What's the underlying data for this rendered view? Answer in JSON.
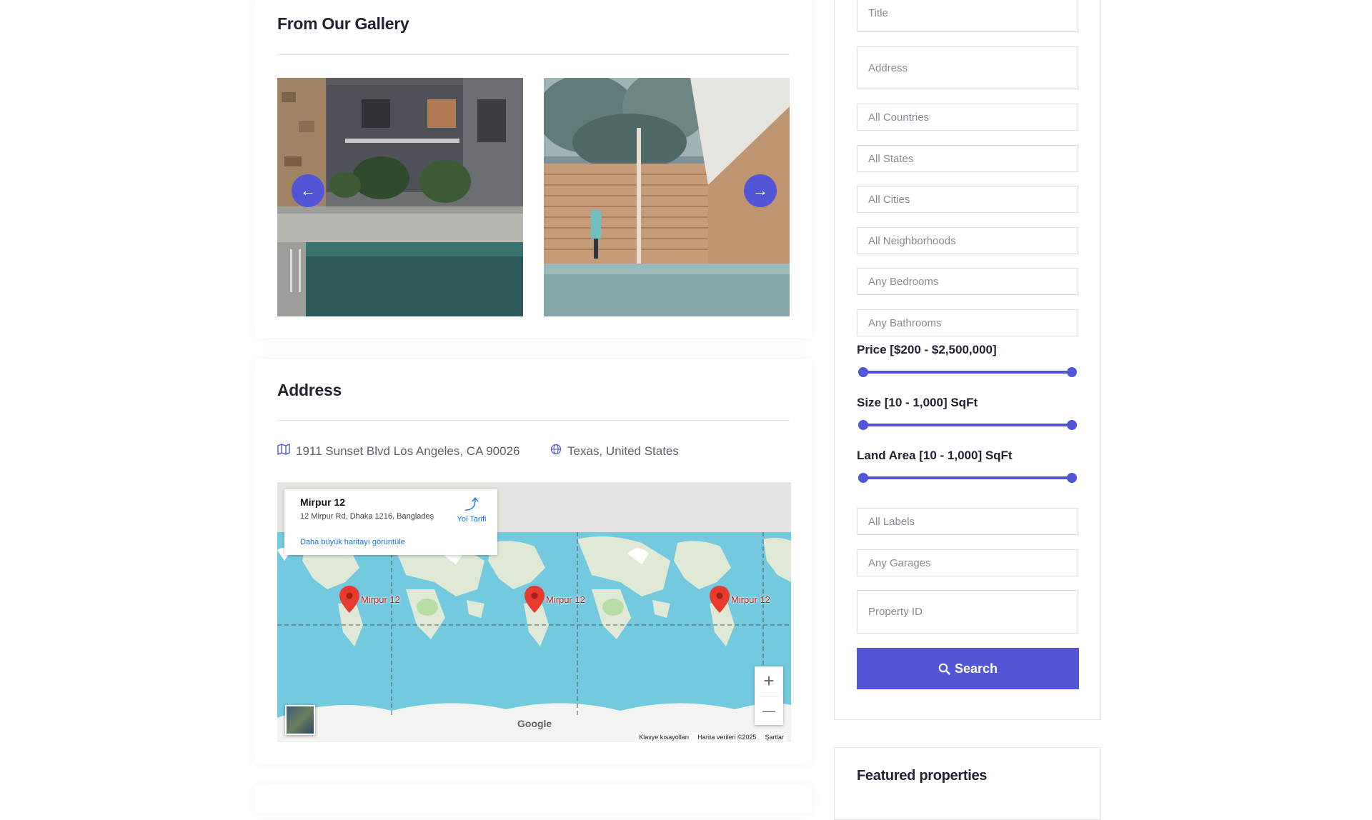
{
  "gallery": {
    "title": "From Our Gallery",
    "prev_icon": "arrow-left-icon",
    "next_icon": "arrow-right-icon"
  },
  "address": {
    "title": "Address",
    "street": "1911 Sunset Blvd Los Angeles, CA 90026",
    "region": "Texas, United States",
    "street_icon": "map-icon",
    "region_icon": "globe-icon"
  },
  "map": {
    "place_name": "Mirpur 12",
    "place_address": "12 Mirpur Rd, Dhaka 1216, Bangladeş",
    "directions": "Yol Tarifi",
    "larger_map": "Daha büyük haritayı görüntüle",
    "marker_label": "Mirpur 12",
    "zoom_in": "+",
    "zoom_out": "—",
    "logo": "Google",
    "footer": {
      "shortcuts": "Klavye kısayolları",
      "map_data": "Harita verileri ©2025",
      "terms": "Şartlar"
    }
  },
  "search_form": {
    "title_placeholder": "Title",
    "address_placeholder": "Address",
    "countries": "All Countries",
    "states": "All States",
    "cities": "All Cities",
    "neighborhoods": "All Neighborhoods",
    "bedrooms": "Any Bedrooms",
    "bathrooms": "Any Bathrooms",
    "price_label": "Price [$200 - $2,500,000]",
    "size_label": "Size [10 - 1,000] SqFt",
    "land_label": "Land Area [10 - 1,000] SqFt",
    "labels": "All Labels",
    "garages": "Any Garages",
    "property_id_placeholder": "Property ID",
    "search_label": "Search",
    "search_icon": "search-icon",
    "accent_color": "#5255d6"
  },
  "featured": {
    "title": "Featured properties"
  }
}
